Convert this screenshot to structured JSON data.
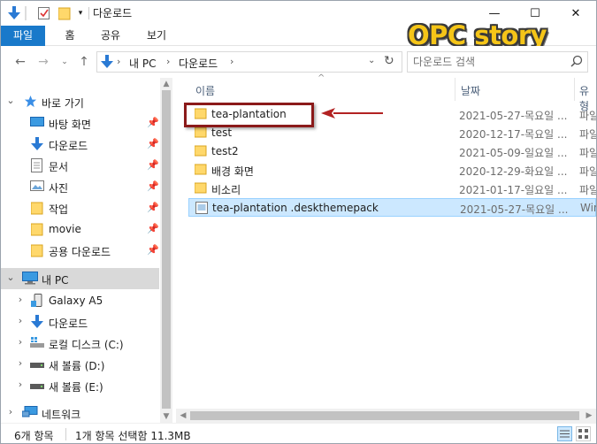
{
  "window": {
    "title": "다운로드"
  },
  "window_controls": {
    "minimize": "—",
    "maximize": "☐",
    "close": "✕"
  },
  "ribbon": {
    "tabs": [
      "파일",
      "홈",
      "공유",
      "보기"
    ]
  },
  "watermark": "OPC story",
  "address": {
    "crumbs": [
      "내 PC",
      "다운로드"
    ],
    "refresh": "↻"
  },
  "search": {
    "placeholder": "다운로드 검색",
    "icon": "magnifier-icon"
  },
  "nav_pane": {
    "quick_access": "바로 가기",
    "quick_items": [
      {
        "label": "바탕 화면",
        "icon": "desktop-icon"
      },
      {
        "label": "다운로드",
        "icon": "download-arrow-icon"
      },
      {
        "label": "문서",
        "icon": "document-icon"
      },
      {
        "label": "사진",
        "icon": "picture-icon"
      },
      {
        "label": "작업",
        "icon": "folder-icon"
      },
      {
        "label": "movie",
        "icon": "folder-icon"
      },
      {
        "label": "공용 다운로드",
        "icon": "folder-icon"
      }
    ],
    "this_pc": "내 PC",
    "pc_items": [
      {
        "label": "Galaxy A5",
        "icon": "phone-icon"
      },
      {
        "label": "다운로드",
        "icon": "download-arrow-icon"
      },
      {
        "label": "로컬 디스크 (C:)",
        "icon": "drive-windows-icon"
      },
      {
        "label": "새 볼륨 (D:)",
        "icon": "drive-icon"
      },
      {
        "label": "새 볼륨 (E:)",
        "icon": "drive-icon"
      }
    ],
    "network": "네트워크"
  },
  "columns": {
    "name": "이름",
    "date": "날짜",
    "type": "유형"
  },
  "files": [
    {
      "name": "tea-plantation",
      "date": "2021-05-27-목요일 ...",
      "type": "파일",
      "kind": "folder"
    },
    {
      "name": "test",
      "date": "2020-12-17-목요일 ...",
      "type": "파일",
      "kind": "folder"
    },
    {
      "name": "test2",
      "date": "2021-05-09-일요일 ...",
      "type": "파일",
      "kind": "folder"
    },
    {
      "name": "배경 화면",
      "date": "2020-12-29-화요일 ...",
      "type": "파일",
      "kind": "folder"
    },
    {
      "name": "비소리",
      "date": "2021-01-17-일요일 ...",
      "type": "파일",
      "kind": "folder"
    },
    {
      "name": "tea-plantation .deskthemepack",
      "date": "2021-05-27-목요일 ...",
      "type": "Win",
      "kind": "file",
      "selected": true
    }
  ],
  "status": {
    "count": "6개 항목",
    "selection": "1개 항목 선택함 11.3MB"
  },
  "colors": {
    "accent": "#1979ca",
    "selection": "#cce8ff",
    "annotation": "#8b1a1a",
    "folder": "#ffd86b"
  }
}
